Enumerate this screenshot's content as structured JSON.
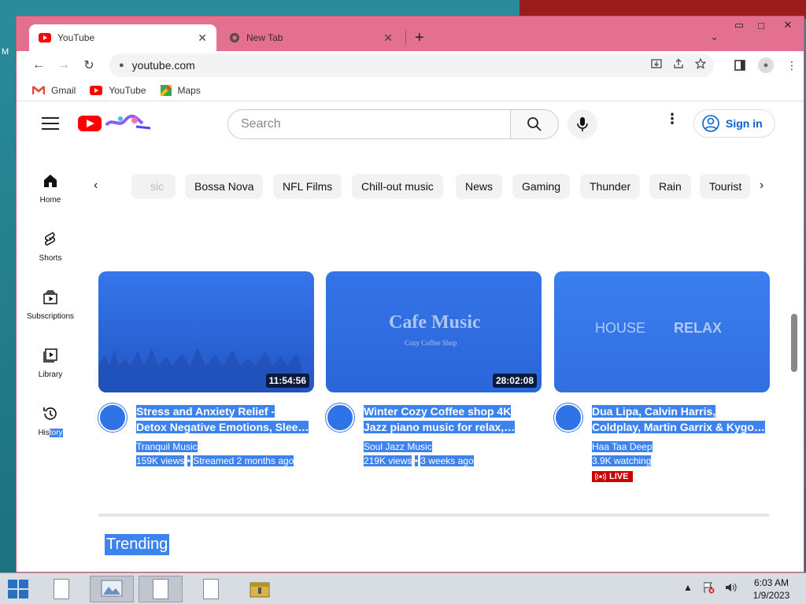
{
  "desktop": {
    "edge_letter": "M"
  },
  "window": {
    "min": "▭",
    "max": "□",
    "close": "✕"
  },
  "tabs": [
    {
      "label": "YouTube",
      "close": "✕",
      "icon": "youtube-icon"
    },
    {
      "label": "New Tab",
      "close": "✕",
      "icon": "chrome-icon"
    }
  ],
  "toolbar": {
    "new_tab": "+",
    "tab_menu": "⌄",
    "back": "←",
    "forward": "→",
    "reload": "↻",
    "url": "youtube.com"
  },
  "bookmarks": [
    {
      "label": "Gmail",
      "icon": "gmail-icon"
    },
    {
      "label": "YouTube",
      "icon": "youtube-icon"
    },
    {
      "label": "Maps",
      "icon": "maps-icon"
    }
  ],
  "yt": {
    "search_placeholder": "Search",
    "sign_in": "Sign in",
    "menu_dots": "⋮"
  },
  "side_nav": [
    {
      "label": "Home",
      "icon": "home-icon"
    },
    {
      "label": "Shorts",
      "icon": "shorts-icon"
    },
    {
      "label": "Subscriptions",
      "icon": "subscriptions-icon"
    },
    {
      "label": "Library",
      "icon": "library-icon"
    },
    {
      "label_a": "His",
      "label_b": "tory",
      "icon": "history-icon"
    }
  ],
  "chips": {
    "prev": "‹",
    "next": "›",
    "items": [
      "sic",
      "Bossa Nova",
      "NFL Films",
      "Chill-out music",
      "News",
      "Gaming",
      "Thunder",
      "Rain",
      "Tourist"
    ]
  },
  "videos": [
    {
      "title_line1": "Stress and Anxiety Relief -",
      "title_line2": "Detox Negative Emotions, Slee…",
      "channel": "Tranquil Music",
      "views": "159K views",
      "sep": "•",
      "age": "Streamed 2 months ago",
      "duration": "11:54:56"
    },
    {
      "title_line1": "Winter Cozy Coffee shop 4K",
      "title_line2": "Jazz piano music for relax,…",
      "channel": "Soul Jazz Music",
      "views": "219K views",
      "sep": "•",
      "age": "3 weeks ago",
      "duration": "28:02:08",
      "thumb_title": "Cafe Music",
      "thumb_sub": "Cozy Coffee Shop"
    },
    {
      "title_line1": "Dua Lipa, Calvin Harris,",
      "title_line2": "Coldplay, Martin Garrix & Kygo…",
      "channel": "Haa Taa Deep",
      "views": "3.9K watching",
      "live": "LIVE",
      "thumb_left": "HOUSE",
      "thumb_right": "RELAX"
    }
  ],
  "section": {
    "trending": "Trending"
  },
  "taskbar": {
    "tray_up": "▲",
    "time": "6:03 AM",
    "date": "1/9/2023"
  },
  "colors": {
    "window_frame": "#e2708e",
    "selection": "#3d83f0",
    "yt_red": "#ff0000",
    "link_blue": "#065fd4"
  }
}
